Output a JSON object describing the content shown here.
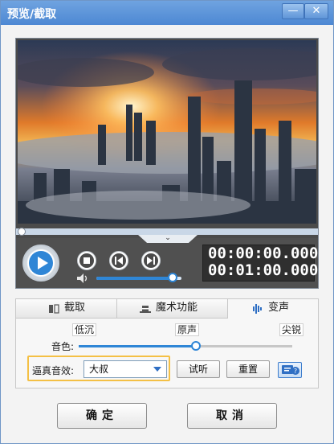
{
  "window": {
    "title": "预览/截取",
    "minimize_glyph": "—",
    "close_glyph": "✕"
  },
  "player": {
    "current_time": "00:00:00.000",
    "total_time": "00:01:00.000",
    "progress": 0.0,
    "volume": 0.9,
    "notch_glyph": "⌄"
  },
  "tabs": [
    {
      "label": "截取",
      "icon": "crop-icon"
    },
    {
      "label": "魔术功能",
      "icon": "magic-hat-icon"
    },
    {
      "label": "变声",
      "icon": "voice-wave-icon",
      "active": true
    }
  ],
  "voice": {
    "pitch_low": "低沉",
    "pitch_orig": "原声",
    "pitch_high": "尖锐",
    "tone_label": "音色:",
    "tone_value": 0.55,
    "effect_label": "逼真音效:",
    "effect_selected": "大叔",
    "listen_label": "试听",
    "reset_label": "重置"
  },
  "footer": {
    "ok_label": "确定",
    "cancel_label": "取消"
  },
  "colors": {
    "accent": "#2f86d6",
    "highlight_box": "#f4c045",
    "titlebar": "#4d88d3"
  }
}
